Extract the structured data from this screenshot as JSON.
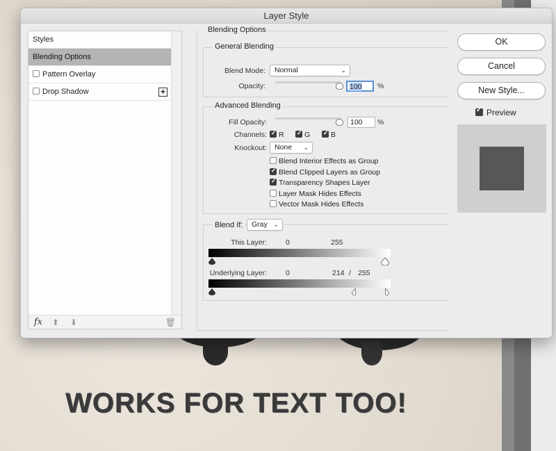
{
  "background": {
    "headline": "WORKS FOR TEXT TOO!"
  },
  "dialog": {
    "title": "Layer Style",
    "styles_panel": {
      "items": [
        {
          "label": "Styles"
        },
        {
          "label": "Blending Options"
        },
        {
          "label": "Pattern Overlay"
        },
        {
          "label": "Drop Shadow"
        }
      ],
      "footer_fx": "fx"
    },
    "blending": {
      "section_title": "Blending Options",
      "general": {
        "title": "General Blending",
        "blend_mode_label": "Blend Mode:",
        "blend_mode_value": "Normal",
        "opacity_label": "Opacity:",
        "opacity_value": "100",
        "percent": "%"
      },
      "advanced": {
        "title": "Advanced Blending",
        "fill_opacity_label": "Fill Opacity:",
        "fill_opacity_value": "100",
        "percent": "%",
        "channels_label": "Channels:",
        "channel_r": "R",
        "channel_g": "G",
        "channel_b": "B",
        "knockout_label": "Knockout:",
        "knockout_value": "None",
        "options": [
          {
            "label": "Blend Interior Effects as Group",
            "checked": false
          },
          {
            "label": "Blend Clipped Layers as Group",
            "checked": true
          },
          {
            "label": "Transparency Shapes Layer",
            "checked": true
          },
          {
            "label": "Layer Mask Hides Effects",
            "checked": false
          },
          {
            "label": "Vector Mask Hides Effects",
            "checked": false
          }
        ]
      },
      "blend_if": {
        "label": "Blend If:",
        "value": "Gray",
        "this_layer_label": "This Layer:",
        "this_layer_low": "0",
        "this_layer_high": "255",
        "underlying_label": "Underlying Layer:",
        "underlying_low": "0",
        "underlying_split": "214",
        "underlying_sep": "/",
        "underlying_high": "255"
      }
    },
    "buttons": {
      "ok": "OK",
      "cancel": "Cancel",
      "new_style": "New Style...",
      "preview": "Preview"
    },
    "colors": {
      "selected_row": "#b4b4b4",
      "focus_ring": "#5b8fd6",
      "preview_square": "#575757"
    }
  }
}
